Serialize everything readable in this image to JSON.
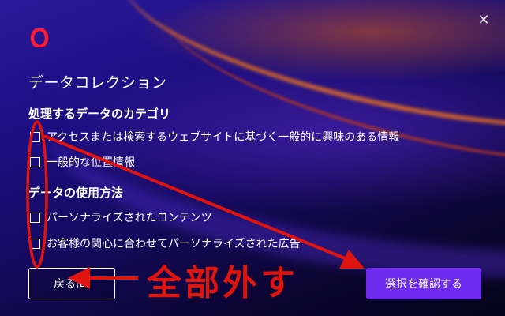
{
  "dialog": {
    "title": "データコレクション",
    "close_symbol": "✕"
  },
  "sections": [
    {
      "heading": "処理するデータのカテゴリ",
      "options": [
        {
          "label": "アクセスまたは検索するウェブサイトに基づく一般的に興味のある情報",
          "checked": false
        },
        {
          "label": "一般的な位置情報",
          "checked": false
        }
      ]
    },
    {
      "heading": "データの使用方法",
      "options": [
        {
          "label": "パーソナライズされたコンテンツ",
          "checked": false
        },
        {
          "label": "お客様の関心に合わせてパーソナライズされた広告",
          "checked": false
        }
      ]
    }
  ],
  "buttons": {
    "back_label": "戻る",
    "back_accel": "(B)",
    "confirm_label": "選択を確認する"
  },
  "annotation": {
    "text": "全部外す",
    "color": "#e0140e"
  },
  "colors": {
    "brand": "#ff1b2d",
    "confirm_button": "#6c2bef"
  }
}
